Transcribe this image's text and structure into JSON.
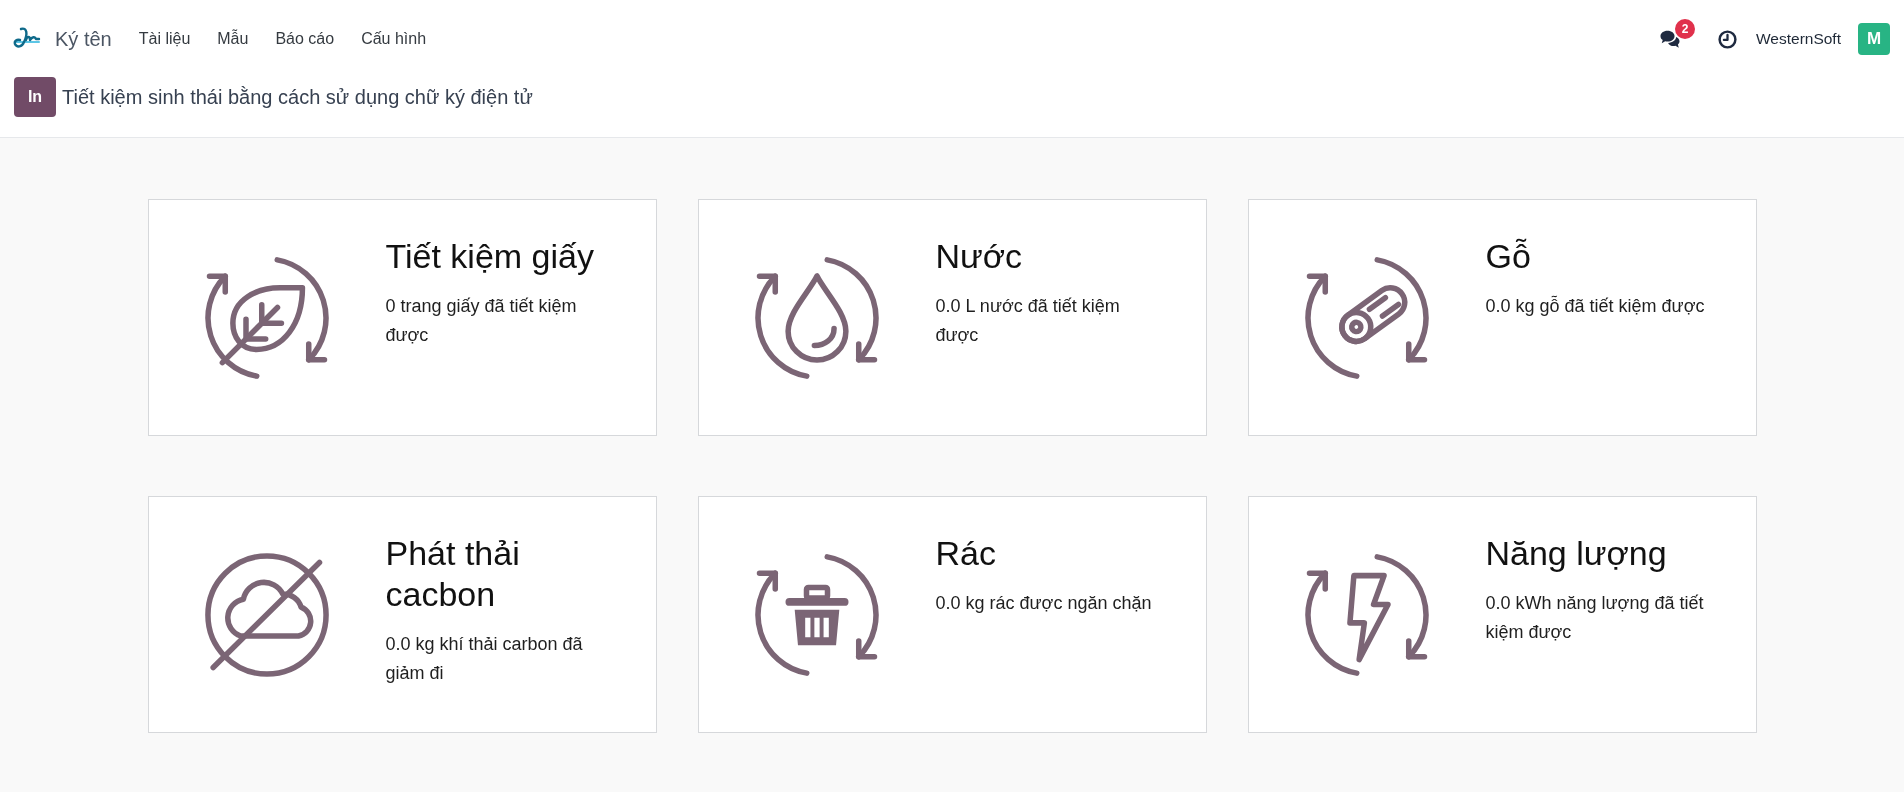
{
  "navbar": {
    "app_name": "Ký tên",
    "menu": [
      "Tài liệu",
      "Mẫu",
      "Báo cáo",
      "Cấu hình"
    ],
    "messages_badge": "2",
    "company": "WesternSoft",
    "avatar": "M"
  },
  "control_panel": {
    "badge": "In",
    "title": "Tiết kiệm sinh thái bằng cách sử dụng chữ ký điện tử"
  },
  "cards": [
    {
      "kind": "paper",
      "title": "Tiết kiệm giấy",
      "description": "0 trang giấy đã tiết kiệm được"
    },
    {
      "kind": "water",
      "title": "Nước",
      "description": "0.0 L nước đã tiết kiệm được"
    },
    {
      "kind": "wood",
      "title": "Gỗ",
      "description": "0.0 kg gỗ đã tiết kiệm được"
    },
    {
      "kind": "carbon",
      "title": "Phát thải cacbon",
      "description": "0.0 kg khí thải carbon đã giảm đi"
    },
    {
      "kind": "waste",
      "title": "Rác",
      "description": "0.0 kg rác được ngăn chặn"
    },
    {
      "kind": "energy",
      "title": "Năng lượng",
      "description": "0.0 kWh năng lượng đã tiết kiệm được"
    }
  ]
}
